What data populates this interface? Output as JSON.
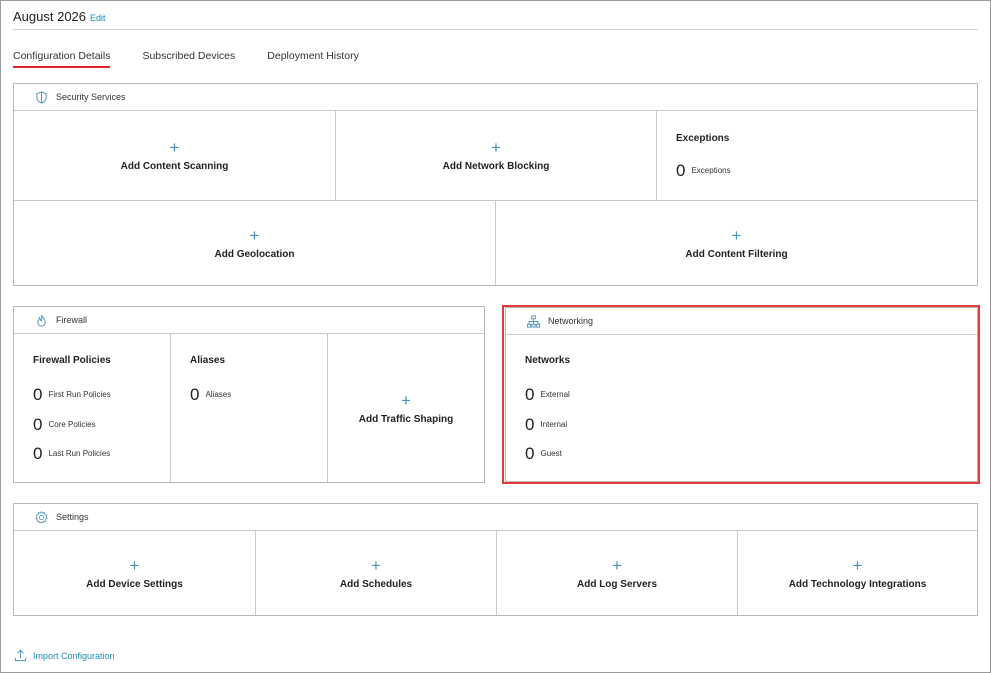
{
  "header": {
    "title": "August 2026",
    "edit_label": "Edit"
  },
  "tabs": [
    {
      "label": "Configuration Details",
      "active": true
    },
    {
      "label": "Subscribed Devices",
      "active": false
    },
    {
      "label": "Deployment History",
      "active": false
    }
  ],
  "security": {
    "title": "Security Services",
    "icon": "shield-icon",
    "add_content_scanning": "Add Content Scanning",
    "add_network_blocking": "Add Network Blocking",
    "exceptions_title": "Exceptions",
    "exceptions_count": "0",
    "exceptions_label": "Exceptions",
    "add_geolocation": "Add Geolocation",
    "add_content_filtering": "Add Content Filtering"
  },
  "firewall": {
    "title": "Firewall",
    "icon": "flame-icon",
    "policies_title": "Firewall Policies",
    "policies": [
      {
        "count": "0",
        "label": "First Run Policies"
      },
      {
        "count": "0",
        "label": "Core Policies"
      },
      {
        "count": "0",
        "label": "Last Run Policies"
      }
    ],
    "aliases_title": "Aliases",
    "aliases_count": "0",
    "aliases_label": "Aliases",
    "add_traffic_shaping": "Add Traffic Shaping"
  },
  "networking": {
    "title": "Networking",
    "icon": "network-tree-icon",
    "networks_title": "Networks",
    "networks": [
      {
        "count": "0",
        "label": "External"
      },
      {
        "count": "0",
        "label": "Internal"
      },
      {
        "count": "0",
        "label": "Guest"
      }
    ]
  },
  "settings": {
    "title": "Settings",
    "icon": "gear-icon",
    "add_device_settings": "Add Device Settings",
    "add_schedules": "Add Schedules",
    "add_log_servers": "Add Log Servers",
    "add_technology_integrations": "Add Technology Integrations"
  },
  "import": {
    "label": "Import Configuration",
    "icon": "upload-icon"
  },
  "colors": {
    "accent": "#e0262b",
    "link": "#1a8fb5",
    "plus": "#4a90b8",
    "highlight": "#e03a3a"
  },
  "plus_glyph": "+"
}
